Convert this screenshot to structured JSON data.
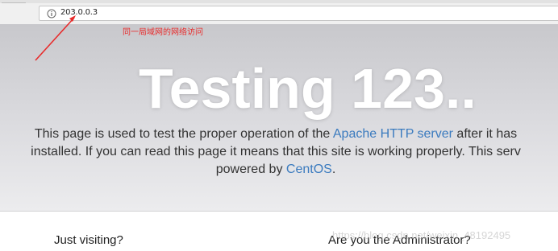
{
  "browser": {
    "url": "203.0.0.3",
    "info_icon": "info-circle-icon"
  },
  "annotation": {
    "text": "同一局域网的网络访问",
    "color": "#e82b2b"
  },
  "hero": {
    "title": "Testing 123..",
    "lead_line1_prefix": "This page is used to test the proper operation of the ",
    "lead_link1": "Apache HTTP server",
    "lead_line1_suffix": " after it has",
    "lead_line2": "installed. If you can read this page it means that this site is working properly. This serv",
    "lead_line3_prefix": "powered by ",
    "lead_link2": "CentOS",
    "lead_line3_suffix": ".",
    "link_color": "#3b7bbf"
  },
  "content": {
    "left_heading": "Just visiting?",
    "right_heading": "Are you the Administrator?"
  },
  "watermark": "https://blog.csdn.net/weixin_48192495"
}
